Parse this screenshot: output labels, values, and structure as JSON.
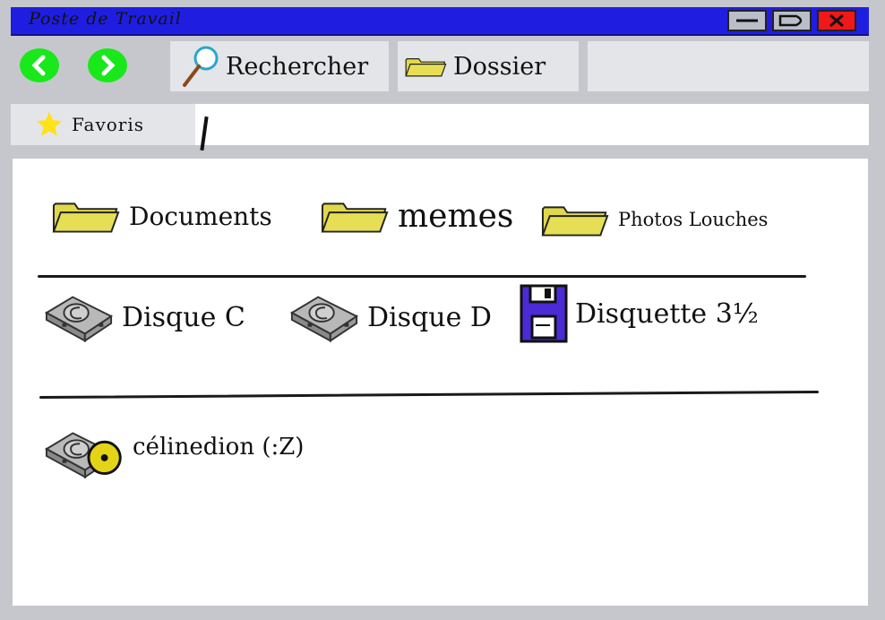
{
  "window": {
    "title": "Poste de Travail"
  },
  "toolbar": {
    "search_label": "Rechercher",
    "folder_label": "Dossier"
  },
  "favorites": {
    "label": "Favoris"
  },
  "folders": [
    {
      "label": "Documents",
      "icon": "folder-icon"
    },
    {
      "label": "memes",
      "icon": "folder-icon"
    },
    {
      "label": "Photos Louches",
      "icon": "folder-icon"
    }
  ],
  "drives": [
    {
      "label": "Disque C",
      "icon": "hard-drive-icon"
    },
    {
      "label": "Disque D",
      "icon": "hard-drive-icon"
    },
    {
      "label": "Disquette 3½",
      "icon": "floppy-disk-icon"
    }
  ],
  "removable": [
    {
      "label": "célinedion (:Z)",
      "icon": "cd-drive-icon"
    }
  ],
  "colors": {
    "titlebar": "#1f1ee0",
    "nav_buttons": "#19e81b",
    "close_button": "#f01818",
    "folder": "#e0d84a",
    "star": "#ffe21a",
    "floppy": "#4b2bd8"
  }
}
